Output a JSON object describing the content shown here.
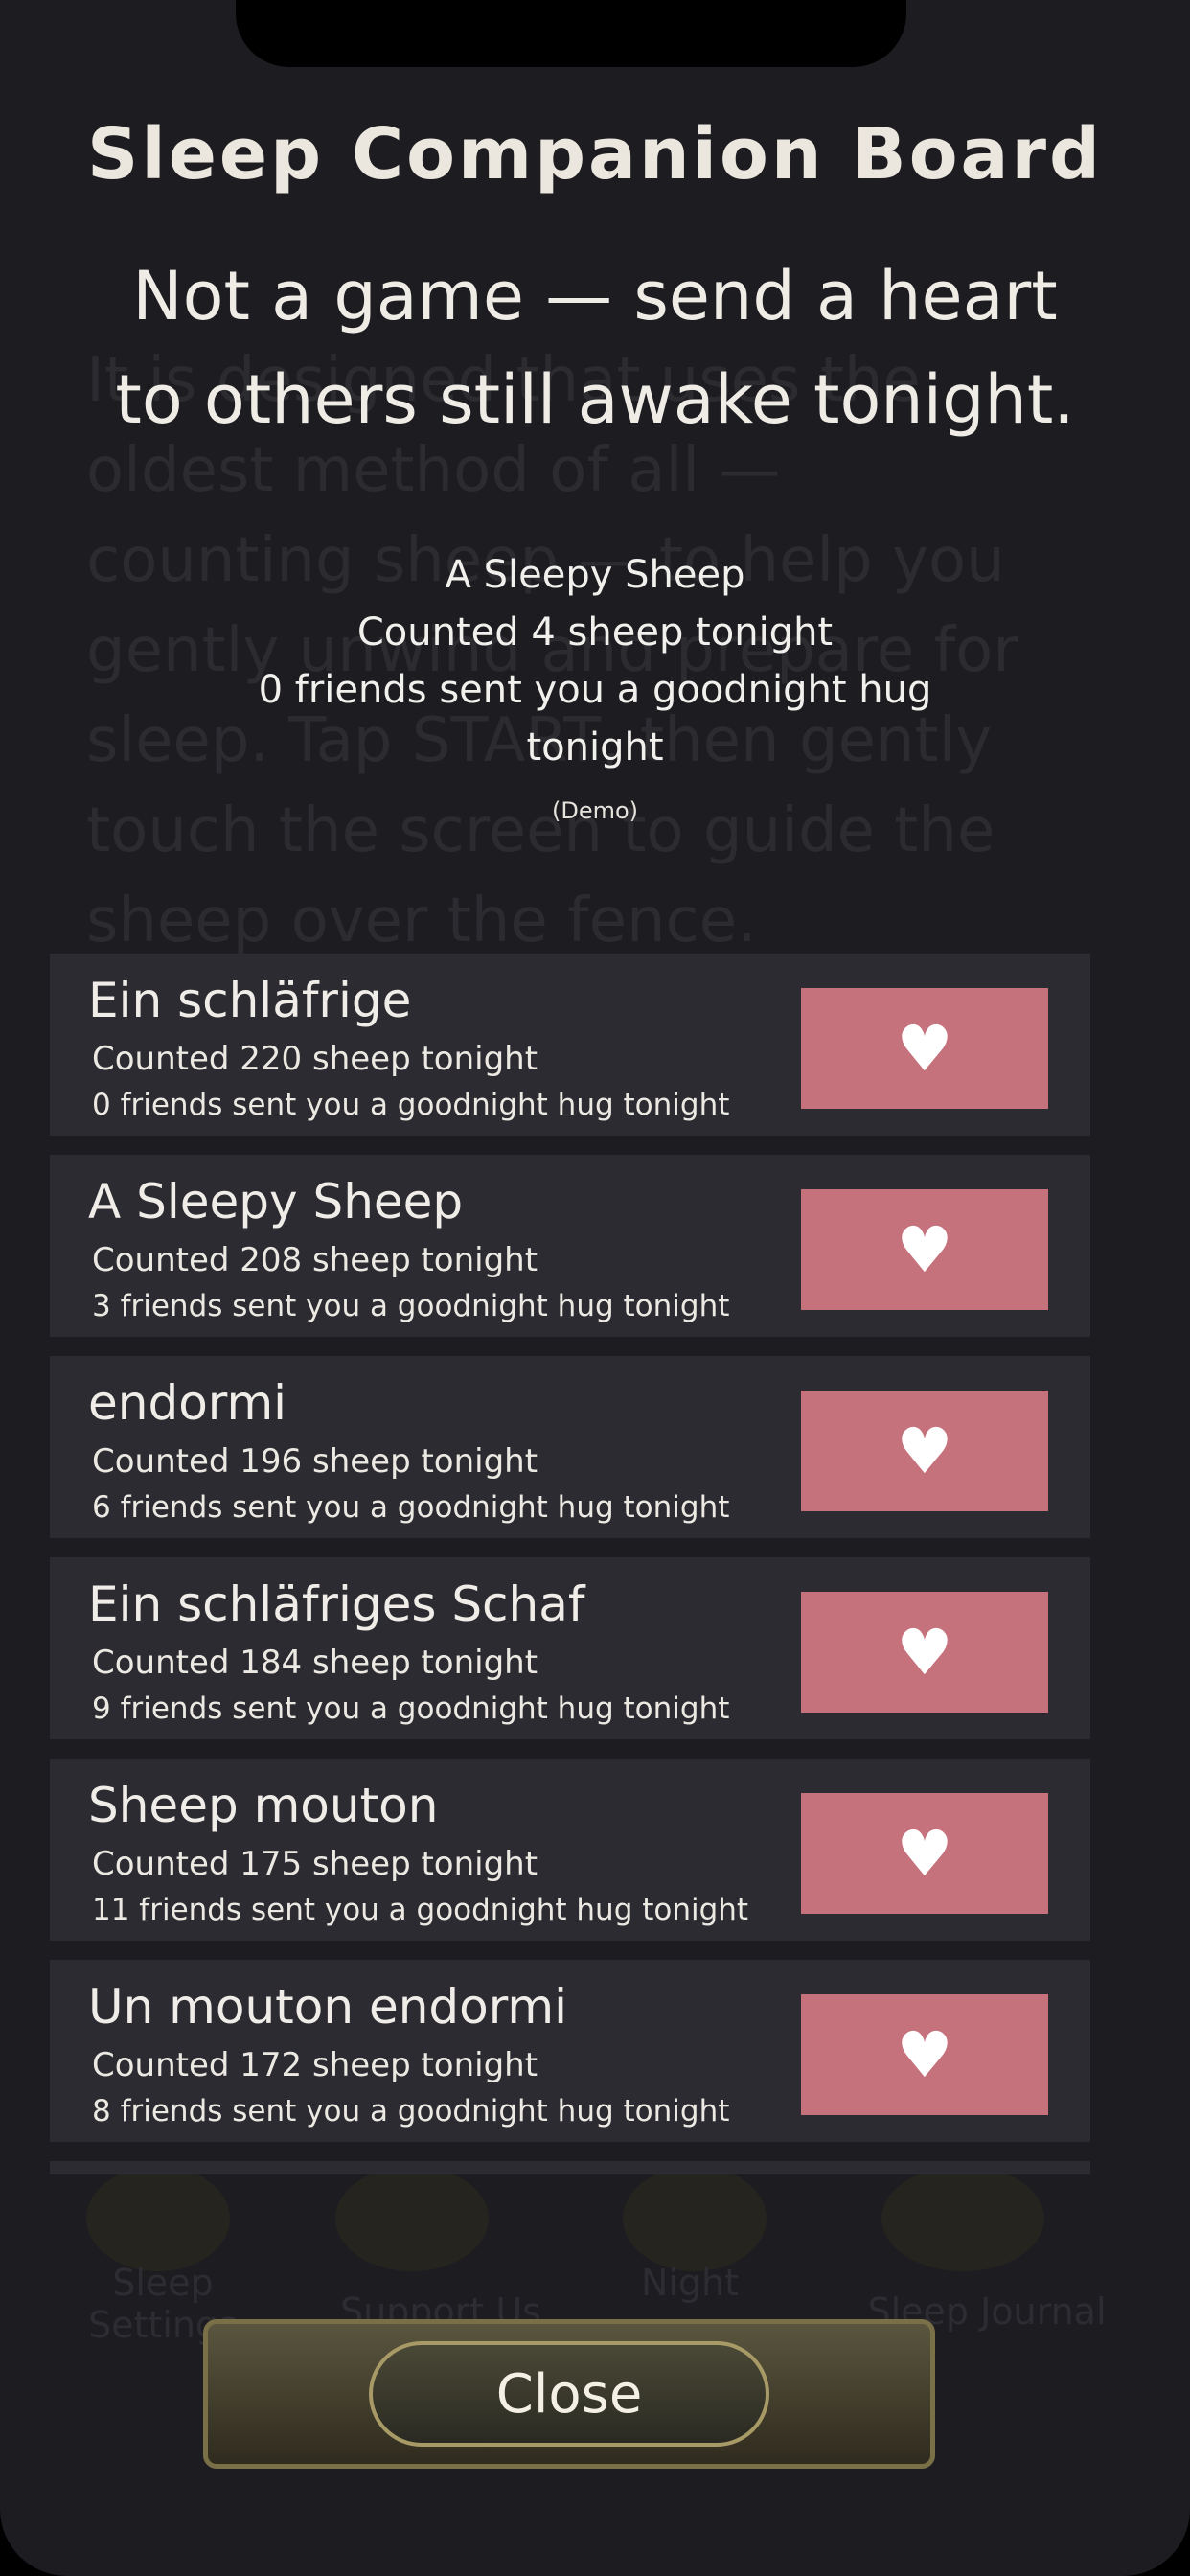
{
  "board": {
    "title": "Sleep Companion Board",
    "subtitle_line1": "Not a game — send a heart",
    "subtitle_line2": "to others still awake tonight."
  },
  "background": {
    "text_lines": [
      "It is designed that uses the",
      "oldest method of all —",
      "counting sheep — to help you",
      "gently unwind and prepare for",
      "sleep. Tap START, then gently",
      "touch the screen to guide the",
      "sheep over the fence."
    ],
    "menu": [
      {
        "label_line1": "Sleep",
        "label_line2": "Settings"
      },
      {
        "label_line1": "Support Us",
        "label_line2": ""
      },
      {
        "label_line1": "Night",
        "label_line2": ""
      },
      {
        "label_line1": "Sleep Journal",
        "label_line2": ""
      }
    ]
  },
  "me": {
    "name": "A Sleepy Sheep",
    "count_text": "Counted 4 sheep tonight",
    "friends_text_line1": "0 friends sent you a goodnight hug",
    "friends_text_line2": "tonight",
    "demo": "(Demo)"
  },
  "entries": [
    {
      "name": "Ein schläfrige",
      "count_text": "Counted 220 sheep tonight",
      "friends_text": "0 friends sent you a goodnight hug tonight",
      "button_icon": "heart-icon"
    },
    {
      "name": "A Sleepy Sheep",
      "count_text": "Counted 208 sheep tonight",
      "friends_text": "3 friends sent you a goodnight hug tonight",
      "button_icon": "heart-icon"
    },
    {
      "name": "endormi",
      "count_text": "Counted 196 sheep tonight",
      "friends_text": "6 friends sent you a goodnight hug tonight",
      "button_icon": "heart-icon"
    },
    {
      "name": "Ein schläfriges Schaf",
      "count_text": "Counted 184 sheep tonight",
      "friends_text": "9 friends sent you a goodnight hug tonight",
      "button_icon": "heart-icon"
    },
    {
      "name": "Sheep  mouton",
      "count_text": "Counted 175 sheep tonight",
      "friends_text": "11 friends sent you a goodnight hug tonight",
      "button_icon": "heart-icon"
    },
    {
      "name": "Un mouton endormi",
      "count_text": "Counted 172 sheep tonight",
      "friends_text": "8 friends sent you a goodnight hug tonight",
      "button_icon": "heart-icon"
    }
  ],
  "heart_glyph": "♥",
  "close_label": "Close",
  "colors": {
    "heart_button": "#c5727c",
    "row_bg": "#2b2b31",
    "panel_bg": "#1c1c21"
  }
}
